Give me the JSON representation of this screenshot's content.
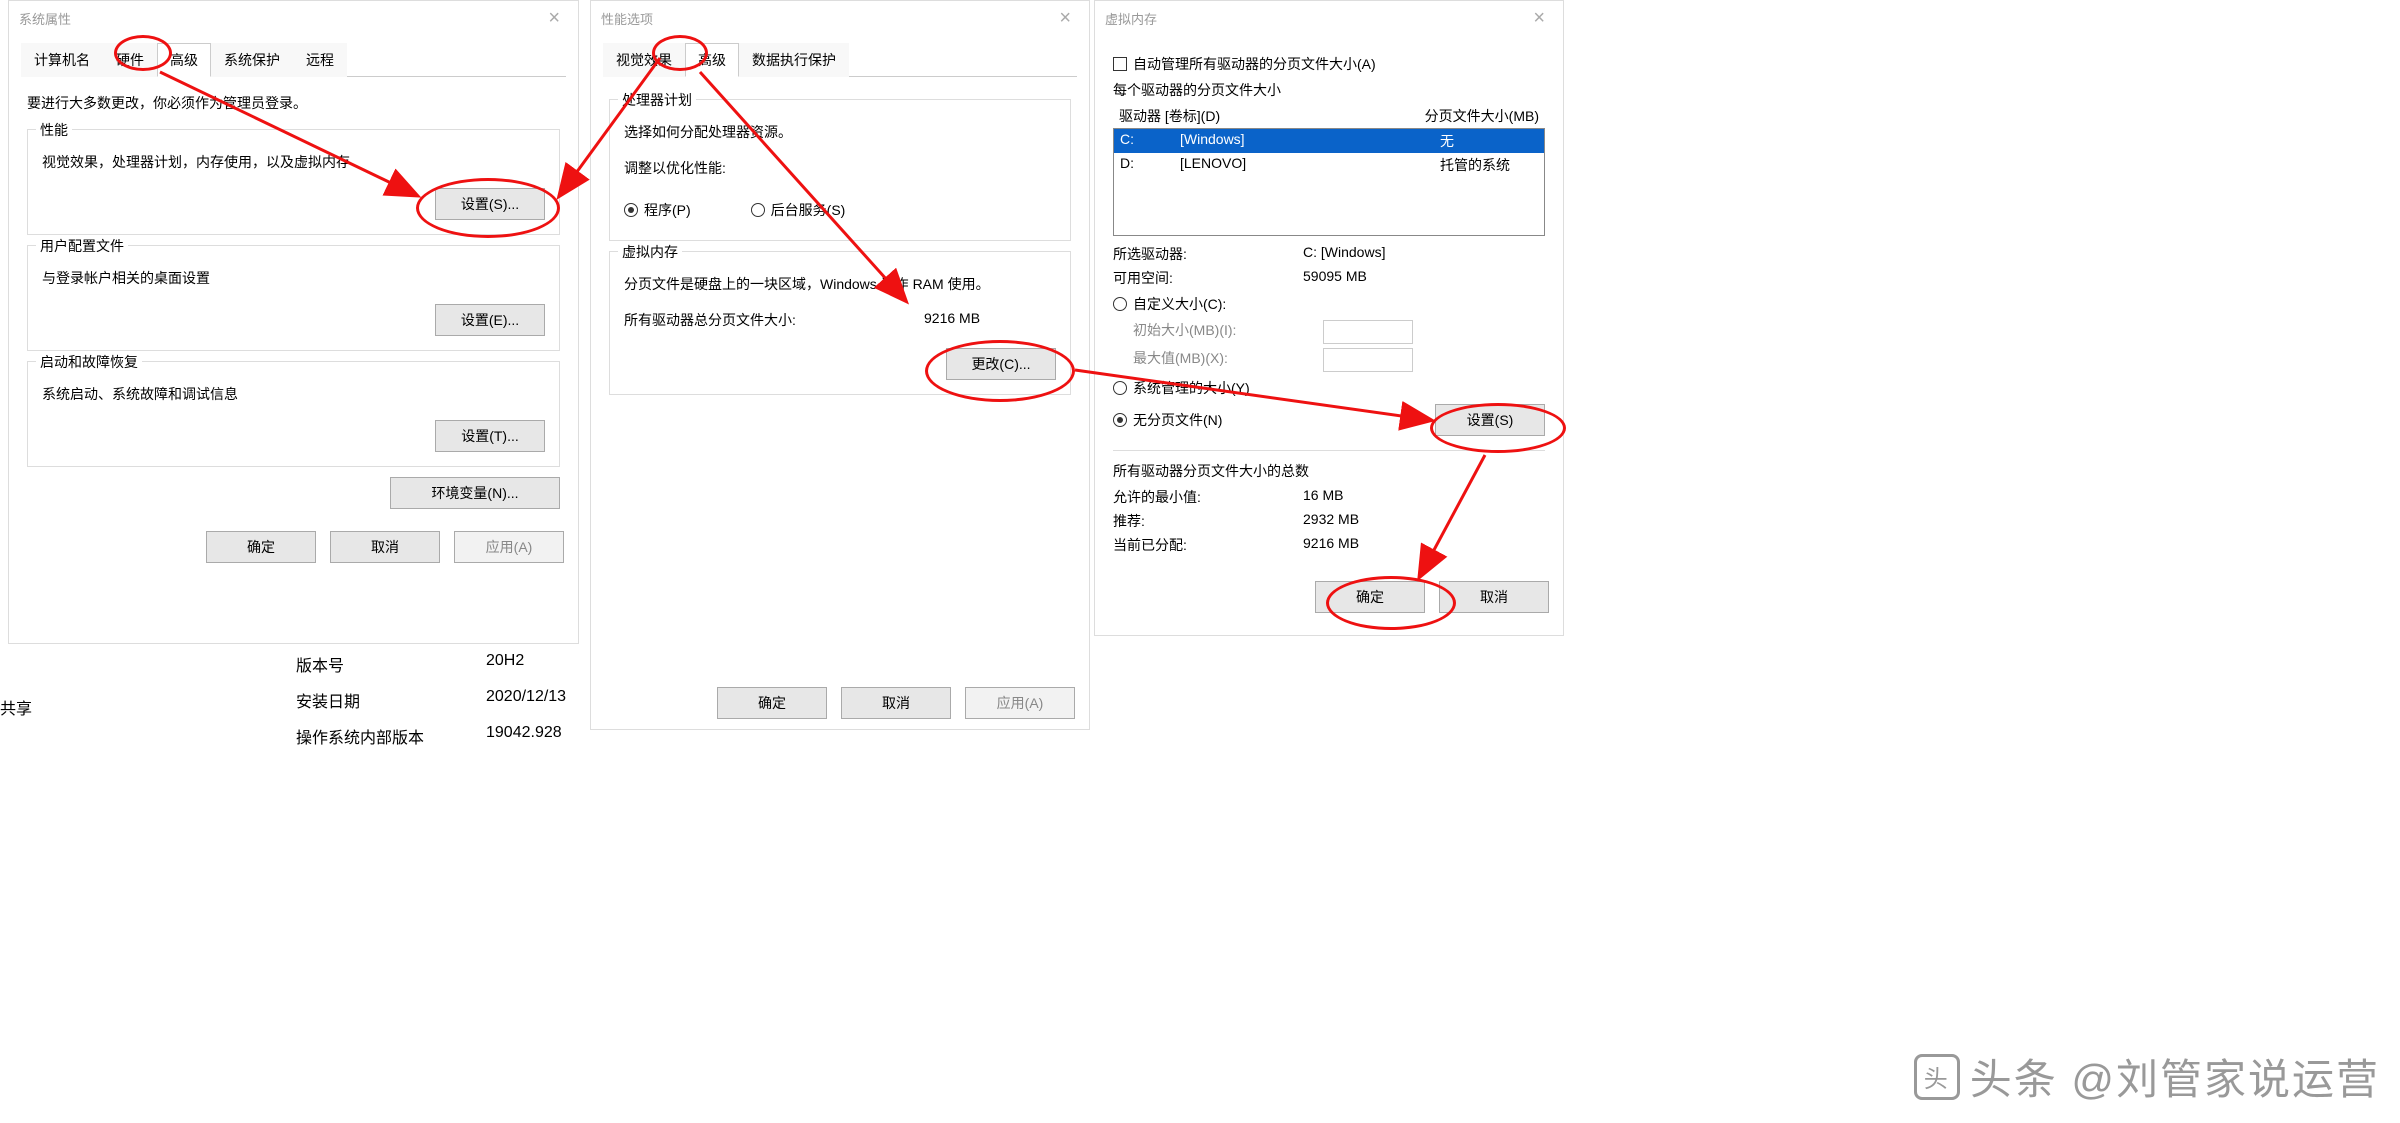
{
  "dialog1": {
    "title": "系统属性",
    "tabs": [
      "计算机名",
      "硬件",
      "高级",
      "系统保护",
      "远程"
    ],
    "active_tab_index": 2,
    "admin_note": "要进行大多数更改，你必须作为管理员登录。",
    "groups": {
      "perf": {
        "title": "性能",
        "desc": "视觉效果，处理器计划，内存使用，以及虚拟内存",
        "button": "设置(S)..."
      },
      "profile": {
        "title": "用户配置文件",
        "desc": "与登录帐户相关的桌面设置",
        "button": "设置(E)..."
      },
      "startup": {
        "title": "启动和故障恢复",
        "desc": "系统启动、系统故障和调试信息",
        "button": "设置(T)..."
      }
    },
    "env_button": "环境变量(N)...",
    "footer": {
      "ok": "确定",
      "cancel": "取消",
      "apply": "应用(A)"
    }
  },
  "dialog2": {
    "title": "性能选项",
    "tabs": [
      "视觉效果",
      "高级",
      "数据执行保护"
    ],
    "active_tab_index": 1,
    "sched": {
      "title": "处理器计划",
      "desc": "选择如何分配处理器资源。",
      "adjust_label": "调整以优化性能:",
      "opt_programs": "程序(P)",
      "opt_services": "后台服务(S)"
    },
    "vm": {
      "title": "虚拟内存",
      "desc": "分页文件是硬盘上的一块区域，Windows 当作 RAM 使用。",
      "total_label": "所有驱动器总分页文件大小:",
      "total_value": "9216 MB",
      "change_button": "更改(C)..."
    },
    "footer": {
      "ok": "确定",
      "cancel": "取消",
      "apply": "应用(A)"
    }
  },
  "dialog3": {
    "title": "虚拟内存",
    "auto_manage": "自动管理所有驱动器的分页文件大小(A)",
    "per_drive_label": "每个驱动器的分页文件大小",
    "columns": {
      "drive": "驱动器 [卷标](D)",
      "size": "分页文件大小(MB)"
    },
    "drives": [
      {
        "letter": "C:",
        "label": "[Windows]",
        "size": "无",
        "selected": true
      },
      {
        "letter": "D:",
        "label": "[LENOVO]",
        "size": "托管的系统",
        "selected": false
      }
    ],
    "selected_drive_label": "所选驱动器:",
    "selected_drive_value": "C:  [Windows]",
    "free_space_label": "可用空间:",
    "free_space_value": "59095 MB",
    "custom_size": "自定义大小(C):",
    "initial_label": "初始大小(MB)(I):",
    "max_label": "最大值(MB)(X):",
    "sys_managed": "系统管理的大小(Y)",
    "no_page": "无分页文件(N)",
    "set_button": "设置(S)",
    "totals_label": "所有驱动器分页文件大小的总数",
    "min_label": "允许的最小值:",
    "min_value": "16 MB",
    "rec_label": "推荐:",
    "rec_value": "2932 MB",
    "cur_label": "当前已分配:",
    "cur_value": "9216 MB",
    "footer": {
      "ok": "确定",
      "cancel": "取消"
    }
  },
  "sysinfo": {
    "version_lbl": "版本号",
    "version_val": "20H2",
    "install_lbl": "安装日期",
    "install_val": "2020/12/13",
    "build_lbl": "操作系统内部版本",
    "build_val": "19042.928"
  },
  "share_label": "共享",
  "watermark": "头条 @刘管家说运营"
}
